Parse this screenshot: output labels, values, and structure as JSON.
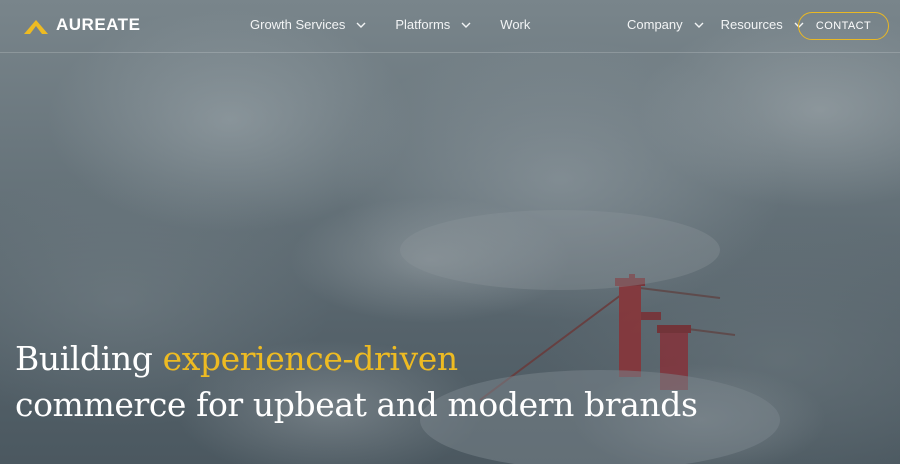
{
  "brand": {
    "name": "AUREATE",
    "logo_icon": "chevron-logo-icon",
    "accent_color": "#eebb22"
  },
  "nav": {
    "left": [
      {
        "label": "Growth Services",
        "has_dropdown": true
      },
      {
        "label": "Platforms",
        "has_dropdown": true
      },
      {
        "label": "Work",
        "has_dropdown": false
      }
    ],
    "right": [
      {
        "label": "Company",
        "has_dropdown": true
      },
      {
        "label": "Resources",
        "has_dropdown": true
      }
    ],
    "contact_label": "CONTACT"
  },
  "hero": {
    "line1_prefix": "Building ",
    "line1_accent": "experience-driven",
    "line2": "commerce for upbeat and modern brands",
    "background": "foggy-bridge-image"
  }
}
